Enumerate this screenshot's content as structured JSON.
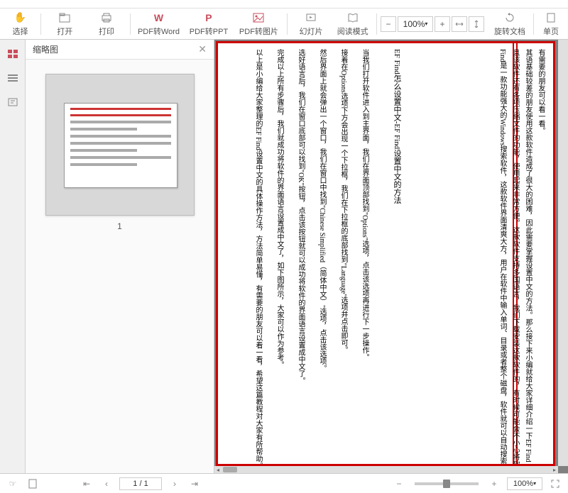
{
  "toolbar": {
    "cursor_top": "手型",
    "cursor_sel": "选择",
    "open": "打开",
    "print": "打印",
    "to_word": "PDF转Word",
    "to_ppt": "PDF转PPT",
    "to_img": "PDF转图片",
    "slides": "幻灯片",
    "reading": "阅读模式",
    "rotate": "旋转文档",
    "single": "单页",
    "zoom_pct": "100%",
    "chev": "▾"
  },
  "thumbs": {
    "title": "缩略图",
    "page1": "1"
  },
  "doc": {
    "title": "EF Find怎么设置中文-EF Find设置中文的方法",
    "p1": "Find是一款功能强大的Windows搜索软件，这款软件界面清爽大方，用户在软件中输入单词、目录或者整个磁盘，软件就可以自动搜索出",
    "p2": "且该软件还有各项压缩文件的功能，使用起来非常方便。这款软件支持多国语言，我们下载安装这款软件的，有时候可能会不小心将软",
    "p3": "其语基础较差的朋友使用这款软件造成了很大的困难，因此需要掌握设置中文的方法。那么接下来小编就给大家详细介绍一下EF Find",
    "p4": "有需要的朋友可以看一看。",
    "s1": "当我们打开软件进入到主界面，我们在界面顶部找到\"Options\"选项，点击该选项再进行下一步操作。",
    "s2": "接着在Options选项下方会出现一个下拉框，我们在下拉框的底部找到\"Language\"选项并点击即可。",
    "s3": "然后界面上就会弹出一个窗口，我们在窗口中找到\"Chinese Simplified（简体中文）\"选项，点击该选项。",
    "s4": "选好语言后，我们在窗口底部可以找到\"OK\"按钮，点击该按钮就可以成功将软件的界面语言设置成中文了。",
    "s5": "完成以上所有步骤后，我们就成功将软件的界面语言设置成中文了，如下图所示，大家可以作为参考。",
    "s6": "以上是小编给大家整理的EF Find设置中文的具体操作方法，方法简单易懂，有需要的朋友可以看一看，希望这篇教程对大家有所帮助。"
  },
  "status": {
    "page": "1 / 1",
    "zoom": "100%"
  }
}
